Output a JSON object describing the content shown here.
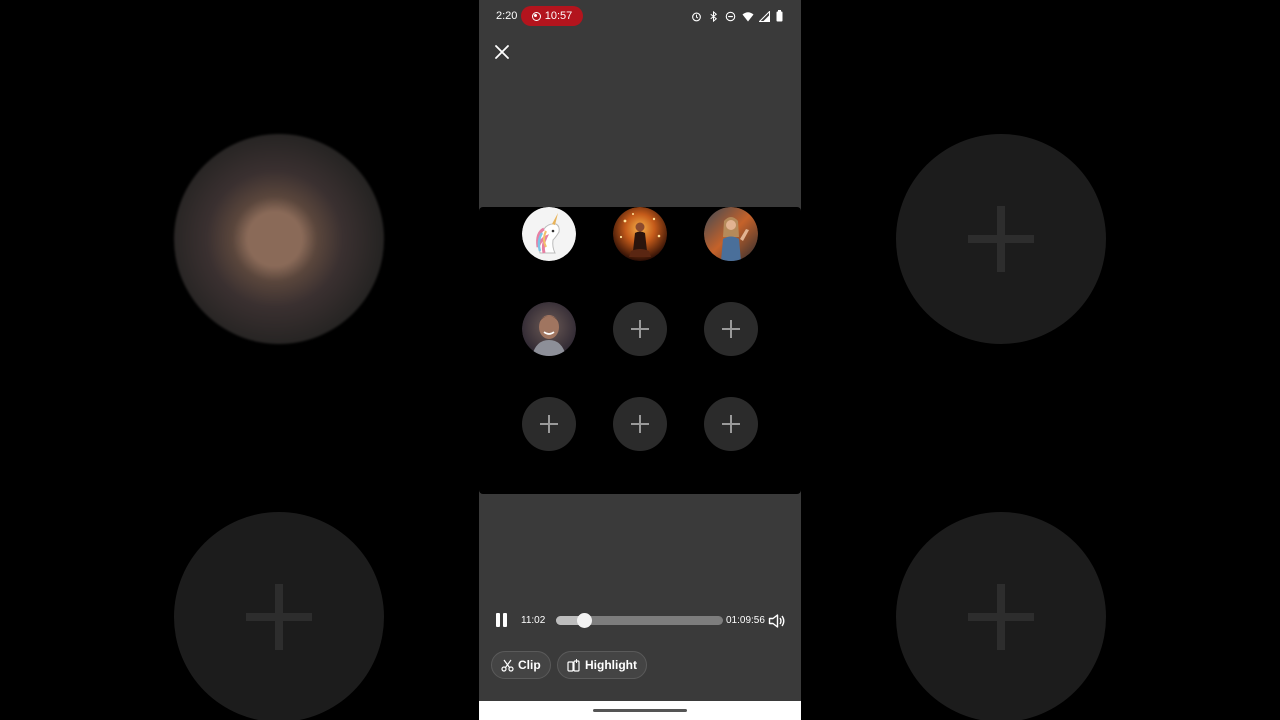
{
  "status_bar": {
    "time": "2:20",
    "recording_time": "10:57",
    "icons": [
      "alarm-icon",
      "bluetooth-icon",
      "do-not-disturb-icon",
      "wifi-icon",
      "signal-icon",
      "battery-icon"
    ]
  },
  "colors": {
    "recording_pill": "#b3141d",
    "screen_background": "#3a3a3a",
    "grid_background": "#000000",
    "empty_slot": "#2b2b2b"
  },
  "header": {
    "close_icon": "close-icon"
  },
  "participants": {
    "avatars": [
      "unicorn-avatar",
      "woman-in-lights-avatar",
      "woman-waving-avatar",
      "smiling-woman-avatar"
    ],
    "empty_slot_icon": "plus-icon",
    "empty_slot_count": 5
  },
  "player": {
    "current_time": "11:02",
    "total_time": "01:09:56",
    "progress": 0.17,
    "pause_icon": "pause-icon",
    "volume_icon": "volume-icon"
  },
  "actions": {
    "clip_label": "Clip",
    "clip_icon": "scissors-icon",
    "highlight_label": "Highlight",
    "highlight_icon": "highlight-icon"
  }
}
